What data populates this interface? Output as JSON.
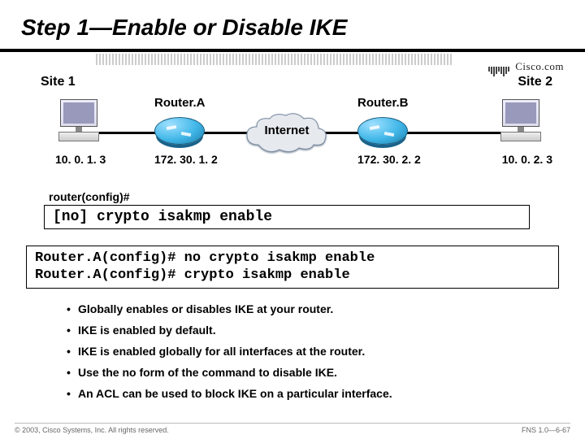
{
  "title": "Step 1—Enable or Disable IKE",
  "brand": "Cisco.com",
  "diagram": {
    "site1_label": "Site 1",
    "site2_label": "Site 2",
    "routerA_label": "Router.A",
    "routerB_label": "Router.B",
    "cloud_label": "Internet",
    "hostA_ip": "10. 0. 1. 3",
    "routerA_ip": "172. 30. 1. 2",
    "routerB_ip": "172. 30. 2. 2",
    "hostB_ip": "10. 0. 2. 3"
  },
  "cmd": {
    "prompt": "router(config)#",
    "syntax": "[no] crypto isakmp enable",
    "example": "Router.A(config)# no crypto isakmp enable\nRouter.A(config)# crypto isakmp enable"
  },
  "bullets": [
    "Globally enables or disables IKE at your router.",
    "IKE is enabled by default.",
    "IKE is enabled globally for all interfaces at the router.",
    "Use the no form of the command to disable IKE.",
    "An ACL can be used to block IKE on a particular interface."
  ],
  "footer": {
    "left": "© 2003, Cisco Systems, Inc. All rights reserved.",
    "right": "FNS 1.0—6-67"
  }
}
